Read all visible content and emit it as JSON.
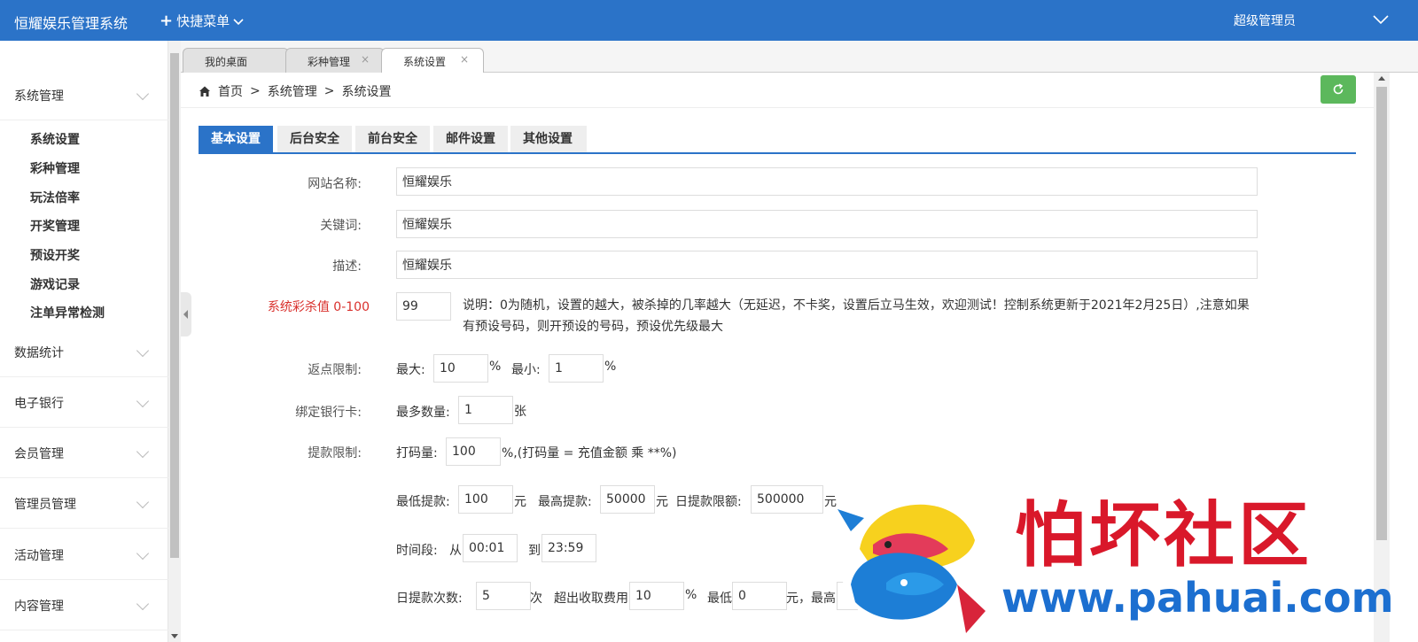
{
  "header": {
    "app_title": "恒耀娱乐管理系统",
    "quick_menu": "快捷菜单",
    "admin_name": "超级管理员"
  },
  "sidebar": {
    "groups": [
      {
        "label": "系统管理",
        "expanded": true
      },
      {
        "label": "数据统计"
      },
      {
        "label": "电子银行"
      },
      {
        "label": "会员管理"
      },
      {
        "label": "管理员管理"
      },
      {
        "label": "活动管理"
      },
      {
        "label": "内容管理"
      }
    ],
    "sub_items": [
      "系统设置",
      "彩种管理",
      "玩法倍率",
      "开奖管理",
      "预设开奖",
      "游戏记录",
      "注单异常检测"
    ]
  },
  "tabs": [
    {
      "label": "我的桌面",
      "closable": false
    },
    {
      "label": "彩种管理",
      "closable": true
    },
    {
      "label": "系统设置",
      "closable": true,
      "active": true
    }
  ],
  "breadcrumb": {
    "home": "首页",
    "sep": ">",
    "level1": "系统管理",
    "level2": "系统设置"
  },
  "form_tabs": [
    "基本设置",
    "后台安全",
    "前台安全",
    "邮件设置",
    "其他设置"
  ],
  "form": {
    "site_name": {
      "label": "网站名称:",
      "value": "恒耀娱乐"
    },
    "keywords": {
      "label": "关键词:",
      "value": "恒耀娱乐"
    },
    "description": {
      "label": "描述:",
      "value": "恒耀娱乐"
    },
    "kill_value": {
      "label": "系统彩杀值 0-100",
      "value": "99",
      "note": "说明：0为随机，设置的越大，被杀掉的几率越大（无延迟，不卡奖，设置后立马生效，欢迎测试！控制系统更新于2021年2月25日）,注意如果有预设号码，则开预设的号码，预设优先级最大"
    },
    "rebate": {
      "label": "返点限制:",
      "max_label": "最大:",
      "max_value": "10",
      "pct": "%",
      "min_label": "最小:",
      "min_value": "1"
    },
    "bind_card": {
      "label": "绑定银行卡:",
      "max_label": "最多数量:",
      "value": "1",
      "unit": "张"
    },
    "withdraw": {
      "label": "提款限制:",
      "bet_label": "打码量:",
      "bet_value": "100",
      "bet_note": "%,(打码量 = 充值金额 乘 **%)",
      "min_label": "最低提款:",
      "min_value": "100",
      "yuan": "元",
      "max_label": "最高提款:",
      "max_value": "50000",
      "daily_label": "日提款限额:",
      "daily_value": "500000",
      "time_label": "时间段:",
      "from_label": "从",
      "from_value": "00:01",
      "to_label": "到",
      "to_value": "23:59",
      "count_label": "日提款次数:",
      "count_value": "5",
      "count_unit": "次",
      "fee_label": "超出收取费用",
      "fee_value": "10",
      "low_label": "最低",
      "low_value": "0",
      "high_label": "元，最高"
    }
  },
  "watermark": {
    "title": "怕坏社区",
    "url": "www.pahuai.com"
  },
  "colors": {
    "primary": "#2b73c8",
    "success": "#5cb85c",
    "danger": "#d9302c",
    "wm_red": "#d9182a",
    "wm_blue": "#1c6fd0"
  }
}
